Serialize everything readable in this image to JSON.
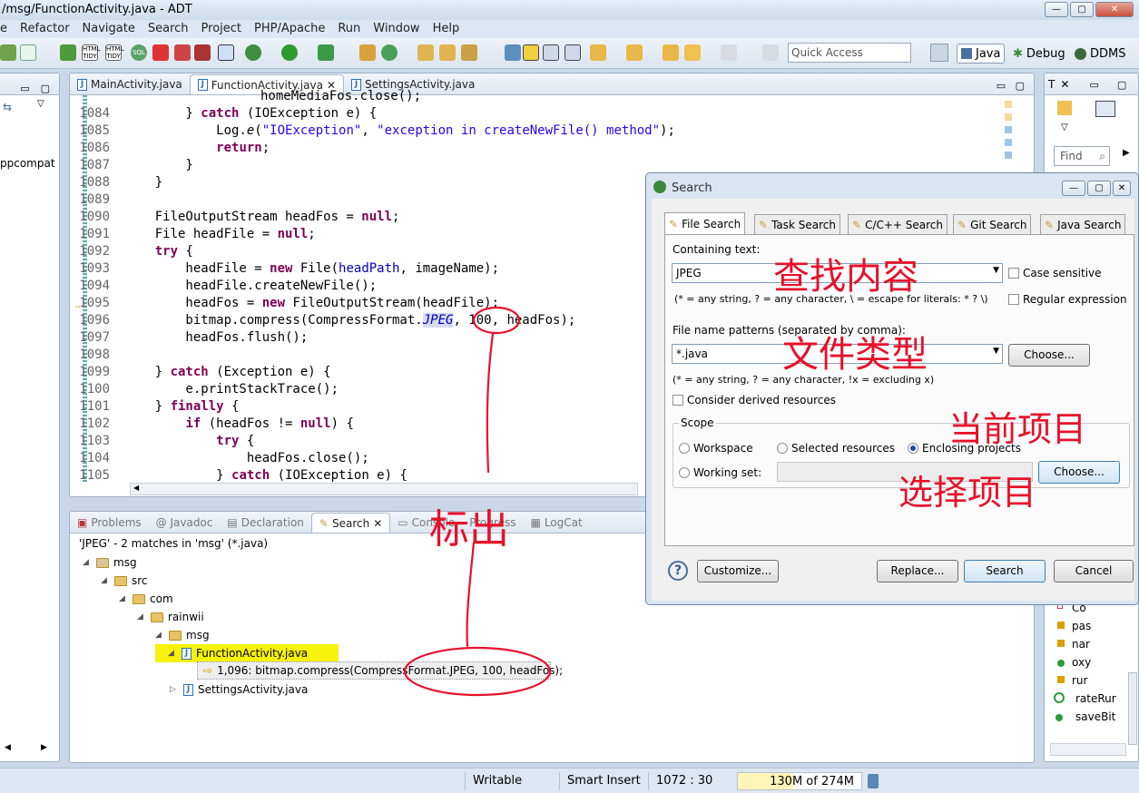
{
  "window": {
    "title": "/msg/FunctionActivity.java - ADT",
    "buttons": [
      "—",
      "▢",
      "✕"
    ]
  },
  "menu": [
    "e",
    "Refactor",
    "Navigate",
    "Search",
    "Project",
    "PHP/Apache",
    "Run",
    "Window",
    "Help"
  ],
  "toolbar": {
    "quick_access_placeholder": "Quick Access",
    "perspectives": [
      "Java",
      "Debug",
      "DDMS"
    ]
  },
  "left_panel": {
    "label": "ppcompat"
  },
  "editor": {
    "tabs": [
      {
        "label": "MainActivity.java"
      },
      {
        "label": "FunctionActivity.java",
        "close": "✕"
      },
      {
        "label": "SettingsActivity.java"
      }
    ],
    "top_partial": "homeMediaFos.close();",
    "lines": [
      "1084",
      "1085",
      "1086",
      "1087",
      "1088",
      "1089",
      "1090",
      "1091",
      "1092",
      "1093",
      "1094",
      "1095",
      "1096",
      "1097",
      "1098",
      "1099",
      "1100",
      "1101",
      "1102",
      "1103",
      "1104",
      "1105"
    ]
  },
  "bottom_panel": {
    "tabs": [
      "Problems",
      "@ Javadoc",
      "Declaration",
      "Search",
      "Console",
      "Progress",
      "LogCat"
    ],
    "summary": "'JPEG' - 2 matches in 'msg' (*.java)",
    "tree": {
      "project": "msg",
      "src": "src",
      "pkg1": "com",
      "pkg2": "rainwii",
      "pkg3": "msg",
      "file1": "FunctionActivity.java",
      "match": "1,096: bitmap.compress(CompressFormat.JPEG, 100, headFos);",
      "file2": "SettingsActivity.java"
    }
  },
  "right_panel": {
    "tab": "T",
    "find": "Find",
    "outline": [
      "Co",
      "pas",
      "nar",
      "oxy",
      "rur",
      "rateRur",
      "saveBit"
    ]
  },
  "dialog": {
    "title": "Search",
    "tabs": [
      "File Search",
      "Task Search",
      "C/C++ Search",
      "Git Search",
      "Java Search"
    ],
    "containing_label": "Containing text:",
    "containing_value": "JPEG",
    "case_sensitive": "Case sensitive",
    "regex": "Regular expression",
    "hint1": "(* = any string, ? = any character, \\ = escape for literals: * ? \\)",
    "patterns_label": "File name patterns (separated by comma):",
    "patterns_value": "*.java",
    "choose": "Choose...",
    "hint2": "(* = any string, ? = any character, !x = excluding x)",
    "derived": "Consider derived resources",
    "scope_label": "Scope",
    "scope": {
      "workspace": "Workspace",
      "selected": "Selected resources",
      "enclosing": "Enclosing projects",
      "working_set": "Working set:"
    },
    "help": "?",
    "customize": "Customize...",
    "replace": "Replace...",
    "search": "Search",
    "cancel": "Cancel"
  },
  "status": {
    "writable": "Writable",
    "insert": "Smart Insert",
    "position": "1072 : 30",
    "memory": "130M of 274M"
  },
  "annotations": {
    "content": "查找内容",
    "file_type": "文件类型",
    "current_project": "当前项目",
    "select_project": "选择项目",
    "marked": "标出"
  }
}
